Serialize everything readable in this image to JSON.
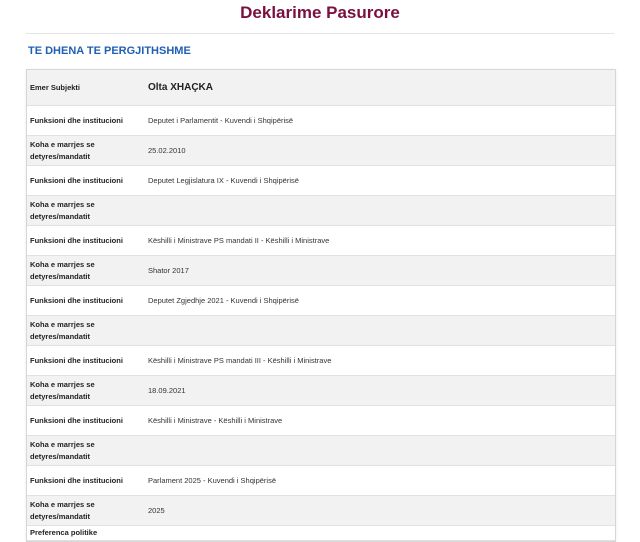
{
  "page": {
    "title": "Deklarime Pasurore",
    "section_heading": "TE DHENA TE PERGJITHSHME"
  },
  "table": {
    "subject_label": "Emer Subjekti",
    "subject_value": "Olta XHAÇKA",
    "rows": [
      {
        "label": "Funksioni dhe institucioni",
        "value": "Deputet i Parlamentit - Kuvendi i Shqipërisë"
      },
      {
        "label": "Koha e marrjes se detyres/mandatit",
        "value": "25.02.2010"
      },
      {
        "label": "Funksioni dhe institucioni",
        "value": "Deputet Legjislatura IX - Kuvendi i Shqipërisë"
      },
      {
        "label": "Koha e marrjes se detyres/mandatit",
        "value": ""
      },
      {
        "label": "Funksioni dhe institucioni",
        "value": "Këshilli i Ministrave PS mandati II - Këshilli i Ministrave"
      },
      {
        "label": "Koha e marrjes se detyres/mandatit",
        "value": "Shator 2017"
      },
      {
        "label": "Funksioni dhe institucioni",
        "value": "Deputet Zgjedhje 2021 - Kuvendi i Shqipërisë"
      },
      {
        "label": "Koha e marrjes se detyres/mandatit",
        "value": ""
      },
      {
        "label": "Funksioni dhe institucioni",
        "value": "Këshilli i Ministrave PS mandati III - Këshilli i Ministrave"
      },
      {
        "label": "Koha e marrjes se detyres/mandatit",
        "value": "18.09.2021"
      },
      {
        "label": "Funksioni dhe institucioni",
        "value": "Këshilli i Ministrave - Këshilli i Ministrave"
      },
      {
        "label": "Koha e marrjes se detyres/mandatit",
        "value": ""
      },
      {
        "label": "Funksioni dhe institucioni",
        "value": "Parlament 2025 - Kuvendi i Shqipërisë"
      },
      {
        "label": "Koha e marrjes se detyres/mandatit",
        "value": "2025"
      }
    ],
    "cut_off_label": "Preferenca politike"
  }
}
